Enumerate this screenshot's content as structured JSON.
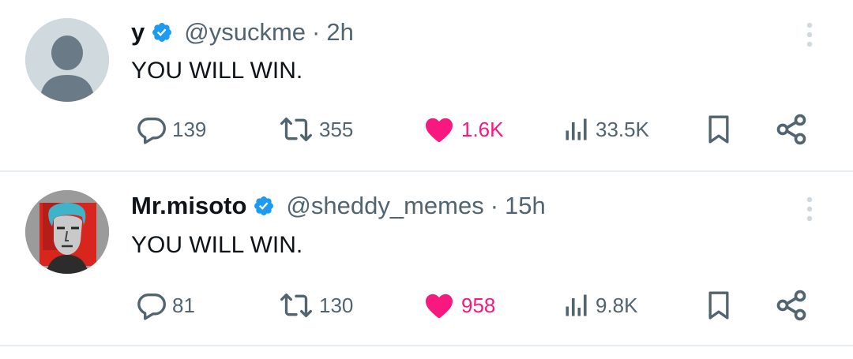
{
  "tweets": [
    {
      "name": "y",
      "handle": "@ysuckme",
      "dot": "·",
      "time": "2h",
      "text": "YOU WILL WIN.",
      "replies": "139",
      "retweets": "355",
      "likes": "1.6K",
      "views": "33.5K",
      "liked": true,
      "avatar": "default-profile-avatar"
    },
    {
      "name": "Mr.misoto",
      "handle": "@sheddy_memes",
      "dot": "·",
      "time": "15h",
      "text": "YOU WILL WIN.",
      "replies": "81",
      "retweets": "130",
      "likes": "958",
      "views": "9.8K",
      "liked": true,
      "avatar": "portrait-avatar"
    }
  ],
  "icons": {
    "verified": "verified-badge-icon",
    "more": "more-vertical-icon",
    "reply": "comment-bubble-icon",
    "retweet": "retweet-icon",
    "like": "heart-filled-icon",
    "views": "bar-chart-icon",
    "bookmark": "bookmark-icon",
    "share": "share-icon"
  },
  "colors": {
    "text": "#0f1419",
    "secondary": "#536471",
    "like": "#f91880",
    "verified": "#1d9bf0",
    "divider": "#e6ecf0"
  }
}
